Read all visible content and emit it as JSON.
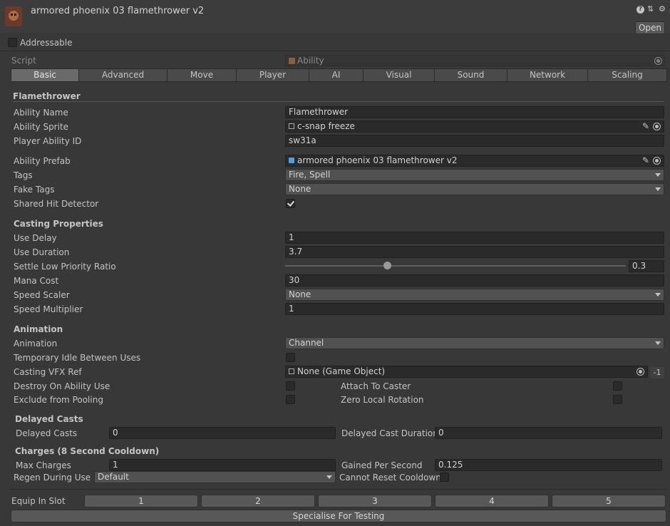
{
  "header": {
    "title": "armored phoenix 03 flamethrower v2",
    "open_label": "Open",
    "addressable_label": "Addressable"
  },
  "script_row": {
    "label": "Script",
    "value": "Ability"
  },
  "tabs": [
    "Basic",
    "Advanced",
    "Move",
    "Player",
    "AI",
    "Visual",
    "Sound",
    "Network",
    "Scaling"
  ],
  "sections": {
    "flamethrower": "Flamethrower",
    "casting": "Casting Properties",
    "animation": "Animation",
    "delayed": "Delayed Casts",
    "charges": "Charges (8 Second Cooldown)"
  },
  "fields": {
    "ability_name": {
      "label": "Ability Name",
      "value": "Flamethrower"
    },
    "ability_sprite": {
      "label": "Ability Sprite",
      "value": "c-snap freeze"
    },
    "player_ability_id": {
      "label": "Player Ability ID",
      "value": "sw31a"
    },
    "ability_prefab": {
      "label": "Ability Prefab",
      "value": "armored phoenix 03 flamethrower v2"
    },
    "tags": {
      "label": "Tags",
      "value": "Fire,  Spell"
    },
    "fake_tags": {
      "label": "Fake Tags",
      "value": "None"
    },
    "shared_hit_detector": {
      "label": "Shared Hit Detector"
    },
    "use_delay": {
      "label": "Use Delay",
      "value": "1"
    },
    "use_duration": {
      "label": "Use Duration",
      "value": "3.7"
    },
    "settle_ratio": {
      "label": "Settle Low Priority Ratio",
      "value": "0.3",
      "fraction": 0.3
    },
    "mana_cost": {
      "label": "Mana Cost",
      "value": "30"
    },
    "speed_scaler": {
      "label": "Speed Scaler",
      "value": "None"
    },
    "speed_multiplier": {
      "label": "Speed Multiplier",
      "value": "1"
    },
    "animation": {
      "label": "Animation",
      "value": "Channel"
    },
    "temp_idle": {
      "label": "Temporary Idle Between Uses"
    },
    "casting_vfx": {
      "label": "Casting VFX Ref",
      "value": "None (Game Object)",
      "badge": "-1"
    },
    "destroy_on_use": {
      "label": "Destroy On Ability Use"
    },
    "attach_to_caster": {
      "label": "Attach To Caster"
    },
    "exclude_pooling": {
      "label": "Exclude from Pooling"
    },
    "zero_local_rotation": {
      "label": "Zero Local Rotation"
    },
    "delayed_casts": {
      "label": "Delayed Casts",
      "value": "0"
    },
    "delayed_cast_duration": {
      "label": "Delayed Cast Duration",
      "value": "0"
    },
    "max_charges": {
      "label": "Max Charges",
      "value": "1"
    },
    "gained_per_second": {
      "label": "Gained Per Second",
      "value": "0.125"
    },
    "regen_during_use": {
      "label": "Regen During Use",
      "value": "Default"
    },
    "cannot_reset_cooldown": {
      "label": "Cannot Reset Cooldown"
    }
  },
  "equip": {
    "label": "Equip In Slot",
    "slots": [
      "1",
      "2",
      "3",
      "4",
      "5"
    ]
  },
  "specialise_label": "Specialise For Testing"
}
